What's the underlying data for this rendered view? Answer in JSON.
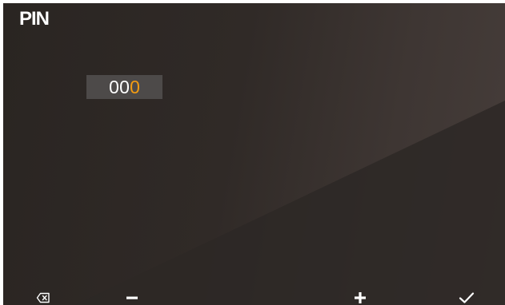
{
  "screen": {
    "title": "PIN"
  },
  "pin": {
    "digits": [
      "0",
      "0",
      "0"
    ],
    "active_index": 2,
    "active_color": "#f39c12"
  },
  "softkeys": [
    {
      "icon": "backspace-icon"
    },
    {
      "icon": "minus-icon"
    },
    {
      "icon": "plus-icon"
    },
    {
      "icon": "checkmark-icon"
    }
  ]
}
